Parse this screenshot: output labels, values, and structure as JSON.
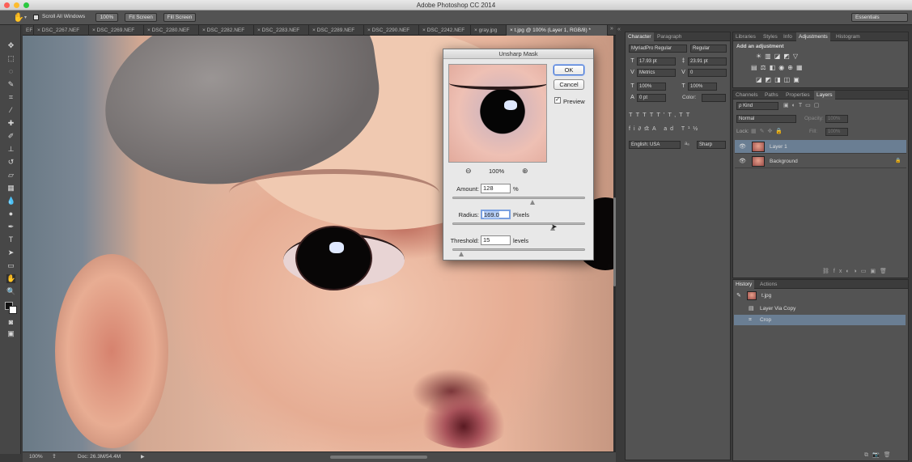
{
  "window": {
    "title": "Adobe Photoshop CC 2014"
  },
  "options_bar": {
    "scroll_all_windows": "Scroll All Windows",
    "zoom_100": "100%",
    "fit_screen": "Fit Screen",
    "fill_screen": "Fill Screen",
    "workspace": "Essentials"
  },
  "doc_tabs": [
    {
      "label": "EF"
    },
    {
      "label": "DSC_2267.NEF"
    },
    {
      "label": "DSC_2269.NEF"
    },
    {
      "label": "DSC_2280.NEF"
    },
    {
      "label": "DSC_2282.NEF"
    },
    {
      "label": "DSC_2283.NEF"
    },
    {
      "label": "DSC_2289.NEF"
    },
    {
      "label": "DSC_2290.NEF"
    },
    {
      "label": "DSC_2242.NEF"
    },
    {
      "label": "gray.jpg"
    },
    {
      "label": "t.jpg @ 100% (Layer 1, RGB/8) *"
    }
  ],
  "status": {
    "zoom": "100%",
    "doc": "Doc: 26.3M/54.4M"
  },
  "dialog": {
    "title": "Unsharp Mask",
    "ok": "OK",
    "cancel": "Cancel",
    "preview_label": "Preview",
    "preview_checked": true,
    "preview_zoom": "100%",
    "amount_label": "Amount:",
    "amount_value": "128",
    "amount_unit": "%",
    "amount_level": 0.6,
    "radius_label": "Radius:",
    "radius_value": "169.0",
    "radius_unit": "Pixels",
    "radius_level": 0.75,
    "threshold_label": "Threshold:",
    "threshold_value": "15",
    "threshold_unit": "levels",
    "threshold_level": 0.06
  },
  "character_panel": {
    "tabs": [
      "Character",
      "Paragraph"
    ],
    "font_family": "MyriadPro Regular",
    "font_style": "Regular",
    "font_size": "17.93 pt",
    "leading": "23.91 pt",
    "kerning": "Metrics",
    "tracking": "0",
    "vscale": "100%",
    "hscale": "100%",
    "baseline": "0 pt",
    "color_label": "Color:",
    "language": "English: USA",
    "antialias": "Sharp",
    "aa_prefix": "aₐ"
  },
  "adjustments_panel": {
    "tabs": [
      "Libraries",
      "Styles",
      "Info",
      "Adjustments",
      "Histogram"
    ],
    "heading": "Add an adjustment"
  },
  "layers_panel": {
    "tabs": [
      "Channels",
      "Paths",
      "Properties",
      "Layers"
    ],
    "kind": "ρ Kind",
    "blend_mode": "Normal",
    "opacity_label": "Opacity:",
    "opacity_value": "100%",
    "lock_label": "Lock:",
    "fill_label": "Fill:",
    "fill_value": "100%",
    "layers": [
      {
        "name": "Layer 1"
      },
      {
        "name": "Background"
      }
    ]
  },
  "history_panel": {
    "tabs": [
      "History",
      "Actions"
    ],
    "snapshot": "t.jpg",
    "states": [
      {
        "name": "Layer Via Copy"
      },
      {
        "name": "Crop"
      }
    ]
  },
  "colors": {
    "accent": "#3d6fd0",
    "selection": "#6a7e93"
  }
}
